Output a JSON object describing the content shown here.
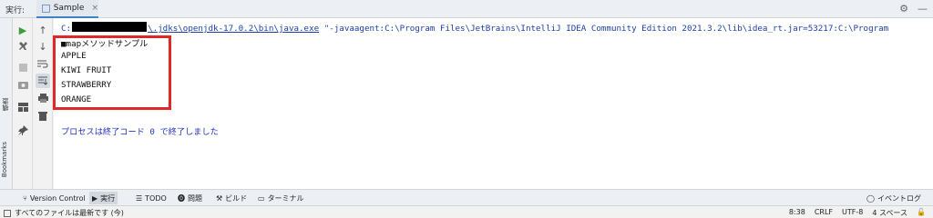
{
  "header": {
    "title": "実行:",
    "tab_label": "Sample",
    "tab_close": "×",
    "gear": "⚙",
    "minimize": "—"
  },
  "left_stripe": {
    "structure": "構造",
    "bookmarks": "Bookmarks"
  },
  "toolbar1_icons": [
    "run-icon",
    "wrench-icon",
    "stop-icon",
    "camera-icon",
    "layout-icon",
    "pin-icon"
  ],
  "toolbar2_icons": [
    "up-arrow-icon",
    "down-arrow-icon",
    "soft-wrap-icon",
    "scroll-to-end-icon",
    "print-icon",
    "trash-icon"
  ],
  "console": {
    "cmd_prefix": "C:",
    "cmd_link": "\\.jdks\\openjdk-17.0.2\\bin\\java.exe",
    "cmd_rest": " \"-javaagent:C:\\Program Files\\JetBrains\\IntelliJ IDEA Community Edition 2021.3.2\\lib\\idea_rt.jar=53217:C:\\Program",
    "output": [
      "■mapメソッドサンプル",
      "APPLE",
      "KIWI FRUIT",
      "STRAWBERRY",
      "ORANGE"
    ],
    "exit_message": "プロセスは終了コード 0 で終了しました"
  },
  "bottom_tabs": [
    {
      "icon": "⑂",
      "label": "Version Control"
    },
    {
      "icon": "▶",
      "label": "実行"
    },
    {
      "icon": "☰",
      "label": "TODO"
    },
    {
      "icon": "⓿",
      "label": "問題"
    },
    {
      "icon": "⚒",
      "label": "ビルド"
    },
    {
      "icon": "▭",
      "label": "ターミナル"
    }
  ],
  "event_log": "イベントログ",
  "status": {
    "message": "すべてのファイルは最新です (今)",
    "time": "8:38",
    "line_sep": "CRLF",
    "encoding": "UTF-8",
    "indent": "4 スペース"
  },
  "colors": {
    "highlight": "#e12828",
    "link": "#1a3fa8",
    "run_green": "#3c9c3c"
  }
}
